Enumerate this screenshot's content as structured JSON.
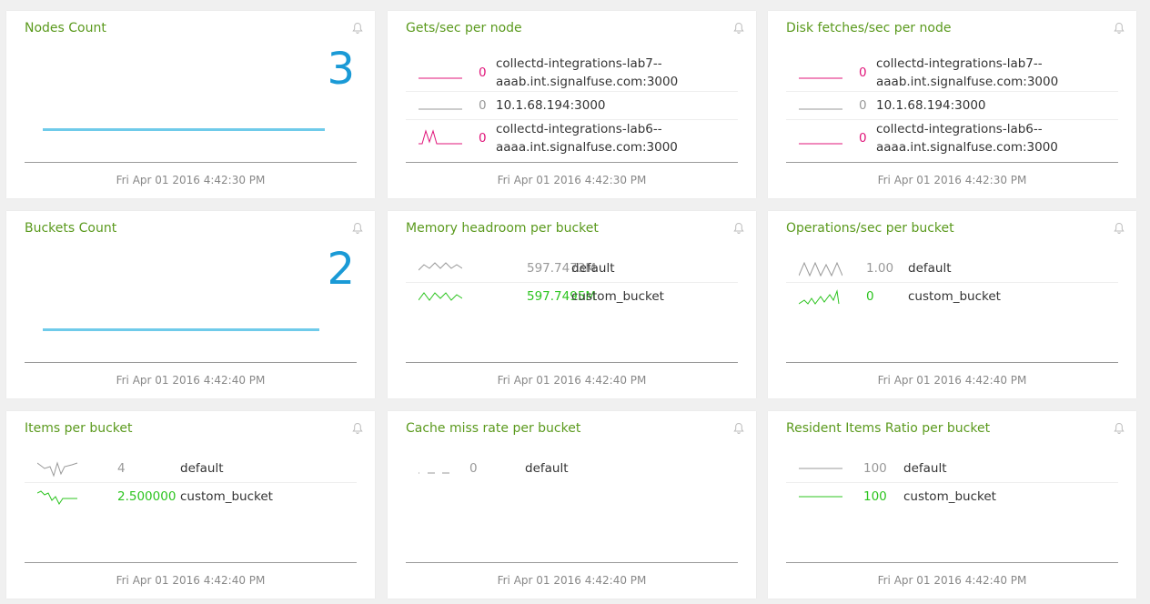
{
  "colors": {
    "title": "#5b9a1e",
    "big": "#1a9ad6",
    "pink": "#e0157a",
    "grey": "#999999",
    "green": "#2cc41f"
  },
  "cards": [
    {
      "title": "Nodes Count",
      "type": "single",
      "value": "3",
      "timestamp": "Fri Apr 01 2016 4:42:30 PM"
    },
    {
      "title": "Gets/sec per node",
      "type": "list",
      "timestamp": "Fri Apr 01 2016 4:42:30 PM",
      "rows": [
        {
          "value": "0",
          "label": "collectd-integrations-lab7--aaab.int.signalfuse.com:3000",
          "label_lines": [
            "collectd-integrations-lab7--",
            "aaab.int.signalfuse.com:3000"
          ],
          "color": "pink"
        },
        {
          "value": "0",
          "label": "10.1.68.194:3000",
          "label_lines": [
            "10.1.68.194:3000"
          ],
          "color": "grey"
        },
        {
          "value": "0",
          "label": "collectd-integrations-lab6--aaaa.int.signalfuse.com:3000",
          "label_lines": [
            "collectd-integrations-lab6--",
            "aaaa.int.signalfuse.com:3000"
          ],
          "color": "pink"
        }
      ]
    },
    {
      "title": "Disk fetches/sec per node",
      "type": "list",
      "timestamp": "Fri Apr 01 2016 4:42:30 PM",
      "rows": [
        {
          "value": "0",
          "label": "collectd-integrations-lab7--aaab.int.signalfuse.com:3000",
          "label_lines": [
            "collectd-integrations-lab7--",
            "aaab.int.signalfuse.com:3000"
          ],
          "color": "pink"
        },
        {
          "value": "0",
          "label": "10.1.68.194:3000",
          "label_lines": [
            "10.1.68.194:3000"
          ],
          "color": "grey"
        },
        {
          "value": "0",
          "label": "collectd-integrations-lab6--aaaa.int.signalfuse.com:3000",
          "label_lines": [
            "collectd-integrations-lab6--",
            "aaaa.int.signalfuse.com:3000"
          ],
          "color": "pink"
        }
      ]
    },
    {
      "title": "Buckets Count",
      "type": "single",
      "value": "2",
      "timestamp": "Fri Apr 01 2016 4:42:40 PM"
    },
    {
      "title": "Memory headroom per bucket",
      "type": "list",
      "timestamp": "Fri Apr 01 2016 4:42:40 PM",
      "rows": [
        {
          "value": "597.7473M",
          "label": "default",
          "label_lines": [
            "default"
          ],
          "color": "grey"
        },
        {
          "value": "597.7495M",
          "label": "custom_bucket",
          "label_lines": [
            "custom_bucket"
          ],
          "color": "green"
        }
      ]
    },
    {
      "title": "Operations/sec per bucket",
      "type": "list",
      "timestamp": "Fri Apr 01 2016 4:42:40 PM",
      "rows": [
        {
          "value": "1.00",
          "label": "default",
          "label_lines": [
            "default"
          ],
          "color": "grey"
        },
        {
          "value": "0",
          "label": "custom_bucket",
          "label_lines": [
            "custom_bucket"
          ],
          "color": "green"
        }
      ]
    },
    {
      "title": "Items per bucket",
      "type": "list",
      "timestamp": "Fri Apr 01 2016 4:42:40 PM",
      "rows": [
        {
          "value": "4",
          "label": "default",
          "label_lines": [
            "default"
          ],
          "color": "grey"
        },
        {
          "value": "2.500000",
          "label": "custom_bucket",
          "label_lines": [
            "custom_bucket"
          ],
          "color": "green"
        }
      ]
    },
    {
      "title": "Cache miss rate per bucket",
      "type": "list",
      "timestamp": "Fri Apr 01 2016 4:42:40 PM",
      "rows": [
        {
          "value": "0",
          "label": "default",
          "label_lines": [
            "default"
          ],
          "color": "grey"
        }
      ]
    },
    {
      "title": "Resident Items Ratio per bucket",
      "type": "list",
      "timestamp": "Fri Apr 01 2016 4:42:40 PM",
      "rows": [
        {
          "value": "100",
          "label": "default",
          "label_lines": [
            "default"
          ],
          "color": "grey"
        },
        {
          "value": "100",
          "label": "custom_bucket",
          "label_lines": [
            "custom_bucket"
          ],
          "color": "green"
        }
      ]
    }
  ]
}
